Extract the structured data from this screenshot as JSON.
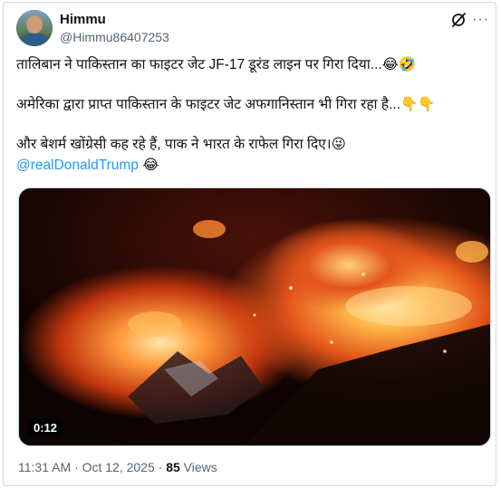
{
  "author": {
    "display_name": "Himmu",
    "handle": "@Himmu86407253"
  },
  "icons": {
    "grok": "grok-icon",
    "more": "more-icon"
  },
  "tweet": {
    "line1": "तालिबान ने पाकिस्तान का फाइटर जेट JF-17 डूरंड लाइन पर गिरा दिया...😂🤣",
    "line2": "अमेरिका द्वारा प्राप्त पाकिस्तान के फाइटर जेट अफगानिस्तान भी गिरा रहा है...👇👇",
    "line3": "और बेशर्म खोंग्रेसी कह रहे हैं, पाक ने भारत के राफेल गिरा दिए।😜",
    "mention": "@realDonaldTrump",
    "mention_suffix": " 😂"
  },
  "media": {
    "type": "video",
    "duration": "0:12"
  },
  "meta": {
    "time": "11:31 AM",
    "separator": " · ",
    "date": "Oct 12, 2025",
    "views_count": "85",
    "views_label": " Views"
  },
  "colors": {
    "link": "#1d9bf0",
    "secondary_text": "#536471",
    "border": "#cfd9de"
  }
}
